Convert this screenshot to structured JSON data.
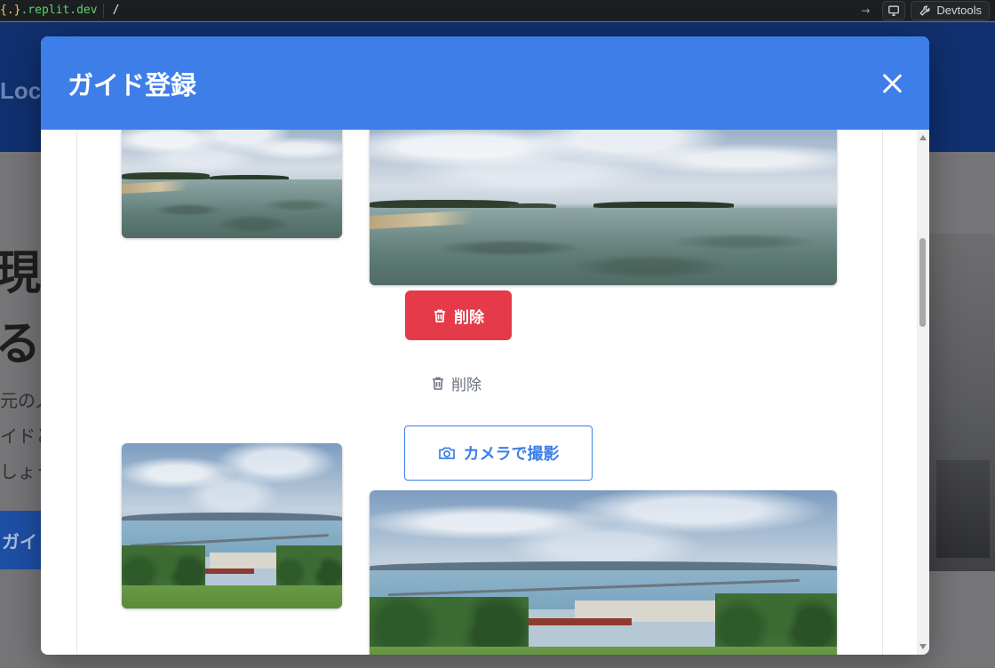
{
  "browser": {
    "host_brace": "{.}",
    "host_suffix": ".replit.dev",
    "path": "/",
    "devtools_label": "Devtools"
  },
  "background_page": {
    "logo_partial": "Loc",
    "hero_line1": "現地",
    "hero_line2": "る、",
    "sub_line1": "元の人",
    "sub_line2": "イドと",
    "sub_line3": "しょう",
    "cta_partial": "ガイ"
  },
  "modal": {
    "title": "ガイド登録",
    "delete_button_label": "削除",
    "delete_link_label": "削除",
    "camera_button_label": "カメラで撮影"
  },
  "colors": {
    "modal_header": "#3d7ee9",
    "delete_button": "#e53a4a",
    "camera_button_border": "#3d7ee9"
  },
  "icons": {
    "close": "close-icon",
    "trash": "trash-icon",
    "camera": "camera-icon",
    "wrench": "wrench-icon",
    "screen": "monitor-icon"
  }
}
